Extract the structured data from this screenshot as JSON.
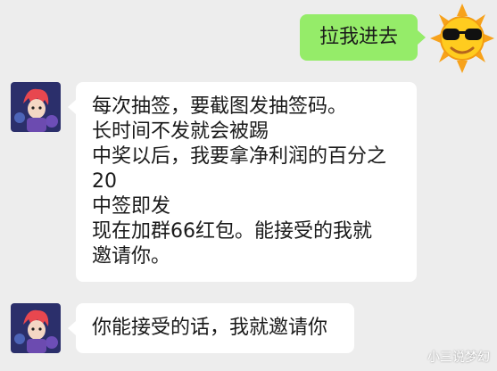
{
  "theme": {
    "background": "#ededed",
    "outgoing_bubble": "#95ec69",
    "incoming_bubble": "#ffffff"
  },
  "messages": [
    {
      "sender": "self",
      "avatar_icon": "sun-sunglasses-icon",
      "lines": [
        "拉我进去"
      ]
    },
    {
      "sender": "other",
      "avatar_icon": "anime-character-avatar-icon",
      "lines": [
        "每次抽签，要截图发抽签码。",
        "长时间不发就会被踢",
        "中奖以后，我要拿净利润的百分之",
        "20",
        "中签即发",
        "现在加群66红包。能接受的我就",
        "邀请你。"
      ]
    },
    {
      "sender": "other",
      "avatar_icon": "anime-character-avatar-icon",
      "lines": [
        "你能接受的话，我就邀请你"
      ]
    }
  ],
  "watermark": "小三说梦幻"
}
